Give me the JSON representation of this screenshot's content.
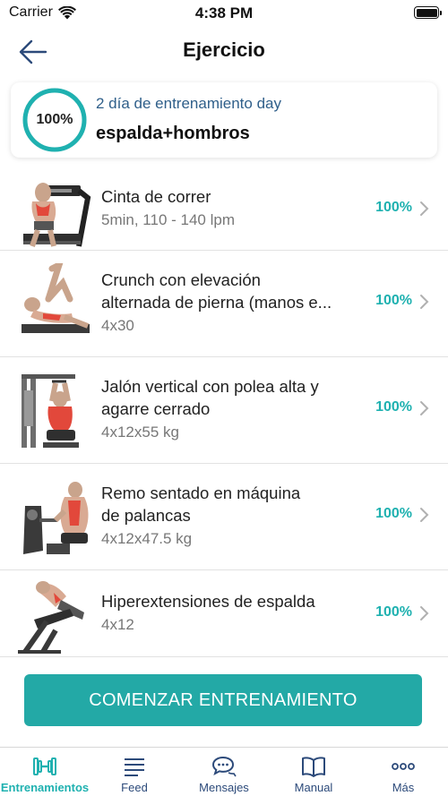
{
  "status_bar": {
    "carrier": "Carrier",
    "time": "4:38 PM",
    "battery_level": 1.0
  },
  "nav": {
    "title": "Ejercicio",
    "back_icon": "arrow-left-icon"
  },
  "day_card": {
    "progress_label": "100%",
    "progress_value": 1.0,
    "subtitle": "2 día de entrenamiento day",
    "name": "espalda+hombros"
  },
  "exercises": [
    {
      "name_line1": "Cinta de correr",
      "name_line2": "",
      "detail": "5min, 110 - 140 lpm",
      "progress": "100%",
      "image": "treadmill-exercise-image"
    },
    {
      "name_line1": "Crunch con elevación",
      "name_line2": "alternada de pierna (manos e...",
      "detail": "4x30",
      "progress": "100%",
      "image": "crunch-exercise-image"
    },
    {
      "name_line1": "Jalón vertical con polea alta y",
      "name_line2": "agarre cerrado",
      "detail": "4x12x55 kg",
      "progress": "100%",
      "image": "lat-pulldown-exercise-image"
    },
    {
      "name_line1": "Remo sentado en máquina",
      "name_line2": "de palancas",
      "detail": "4x12x47.5 kg",
      "progress": "100%",
      "image": "seated-row-exercise-image"
    },
    {
      "name_line1": "Hiperextensiones de espalda",
      "name_line2": "",
      "detail": "4x12",
      "progress": "100%",
      "image": "back-extension-exercise-image"
    }
  ],
  "start_button": {
    "label": "COMENZAR ENTRENAMIENTO"
  },
  "tabs": [
    {
      "label": "Entrenamientos",
      "icon": "dumbbell-icon",
      "active": true
    },
    {
      "label": "Feed",
      "icon": "list-icon",
      "active": false
    },
    {
      "label": "Mensajes",
      "icon": "chat-icon",
      "active": false
    },
    {
      "label": "Manual",
      "icon": "book-icon",
      "active": false
    },
    {
      "label": "Más",
      "icon": "more-icon",
      "active": false
    }
  ],
  "colors": {
    "accent": "#23a9a6",
    "progress": "#1fb1b0",
    "tab_inactive": "#2c4a7a",
    "subtitle": "#2f5f8a"
  }
}
